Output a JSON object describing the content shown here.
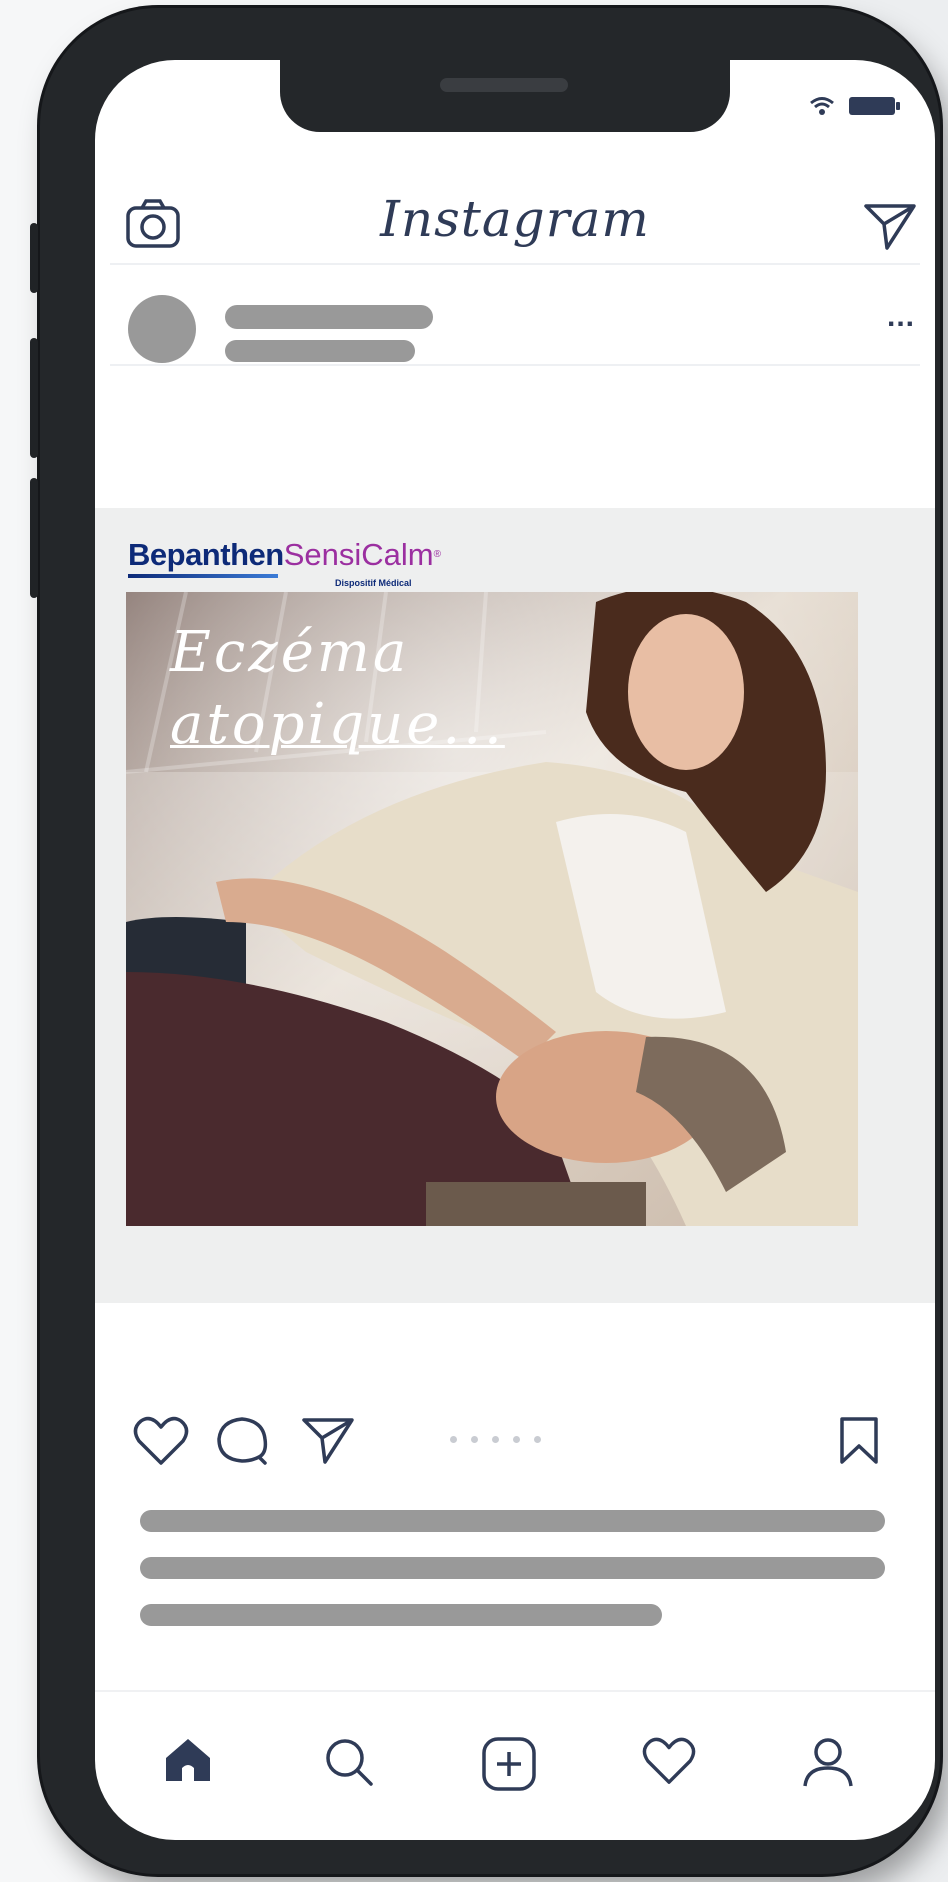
{
  "header": {
    "title": "Instagram"
  },
  "ad": {
    "brand_primary": "Bepanthen",
    "brand_secondary": "SensiCalm",
    "brand_sup": "®",
    "brand_sub": "Dispositif Médical",
    "headline_line1": "Eczéma",
    "headline_line2": "atopique..."
  },
  "post": {
    "more_label": "..."
  },
  "colors": {
    "accent": "#2f3b57",
    "brand_blue": "#0d2a78",
    "brand_purple": "#9b2fa0",
    "placeholder": "#999999"
  },
  "icons": {
    "camera": "camera-icon",
    "direct": "send-icon",
    "like": "heart-icon",
    "comment": "comment-icon",
    "share": "send-icon",
    "save": "bookmark-icon",
    "home": "home-icon",
    "search": "search-icon",
    "add": "add-post-icon",
    "activity": "heart-icon",
    "profile": "profile-icon"
  },
  "carousel": {
    "dot_count": 5
  }
}
